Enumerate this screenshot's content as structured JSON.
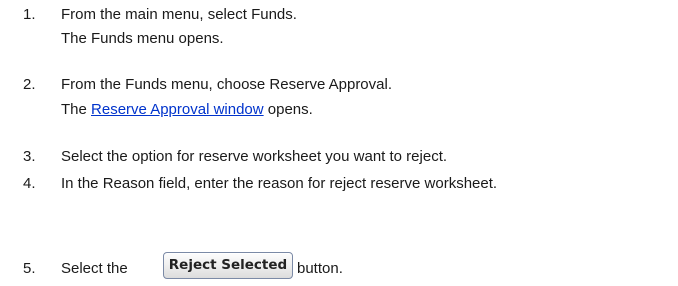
{
  "steps": [
    {
      "number": "1.",
      "text": "From the main menu, select Funds.",
      "result": "The Funds menu opens."
    },
    {
      "number": "2.",
      "text": "From the Funds menu, choose Reserve Approval.",
      "result_prefix": "The ",
      "result_link": "Reserve Approval window",
      "result_suffix": " opens."
    },
    {
      "number": "3.",
      "text": "Select the option for reserve worksheet you want to reject."
    },
    {
      "number": "4.",
      "text": "In the Reason field, enter the reason for reject reserve worksheet."
    },
    {
      "number": "5.",
      "text_before": "Select the",
      "button_label": "Reject Selected",
      "text_after": "button."
    }
  ]
}
